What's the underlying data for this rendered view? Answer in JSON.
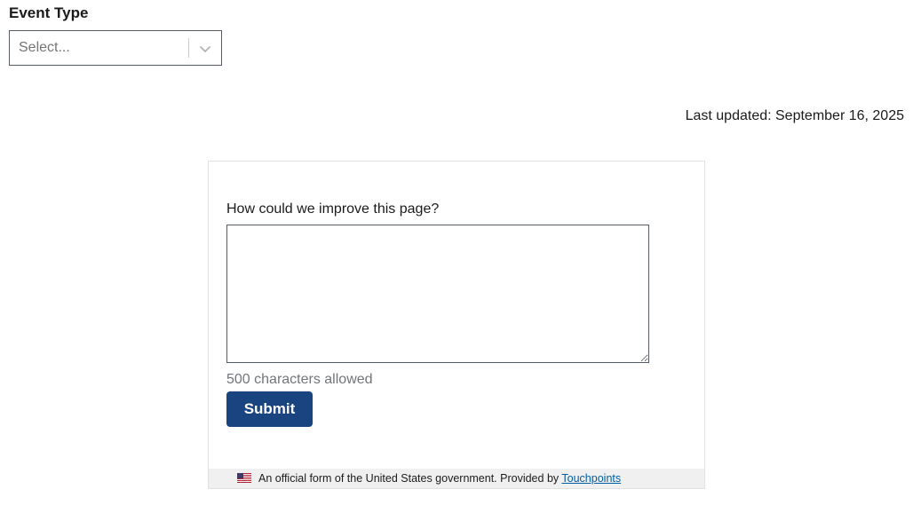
{
  "filter": {
    "label": "Event Type",
    "select": {
      "placeholder": "Select...",
      "icon": "chevron-down-icon"
    }
  },
  "last_updated": "Last updated: September 16, 2025",
  "feedback": {
    "question": "How could we improve this page?",
    "textarea_value": "",
    "char_limit_text": "500 characters allowed",
    "submit_label": "Submit",
    "footer": {
      "flag_icon": "us-flag-icon",
      "text": "An official form of the United States government. Provided by",
      "link_text": "Touchpoints"
    }
  },
  "colors": {
    "submit_bg": "#1a4480",
    "link": "#005ea2",
    "footer_bg": "#f0f0f0"
  }
}
